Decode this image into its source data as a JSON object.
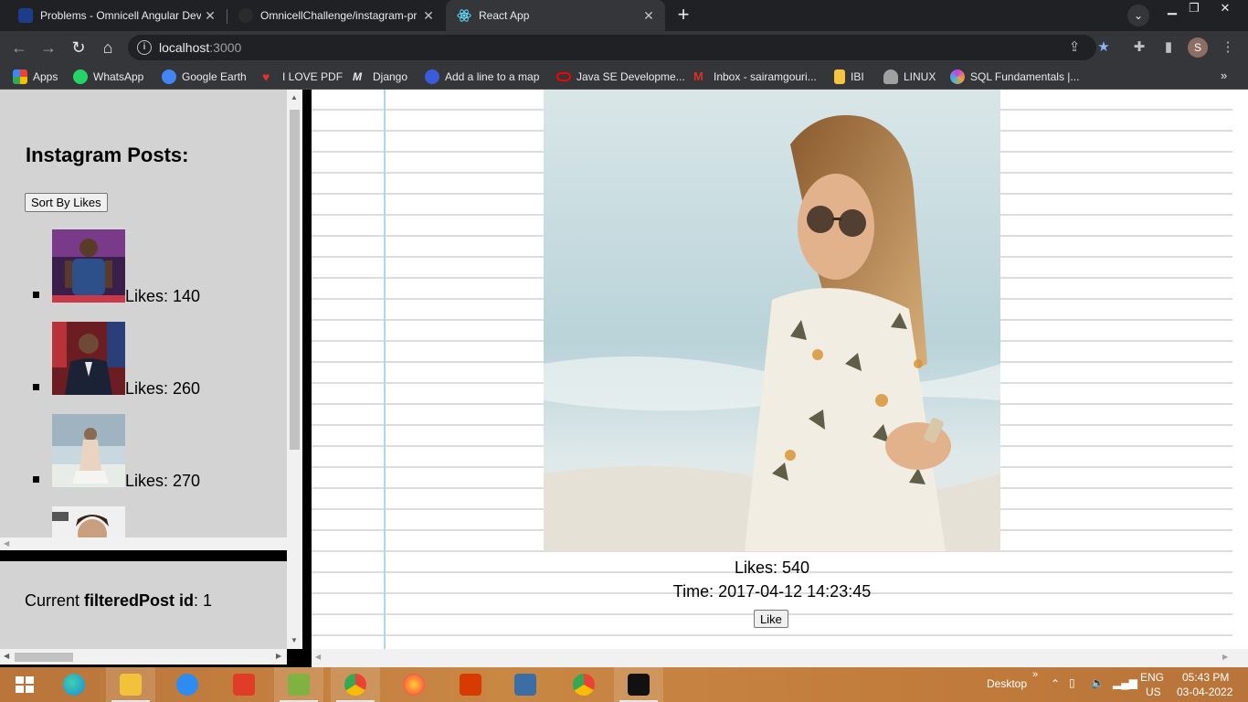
{
  "browser": {
    "tabs": [
      {
        "title": "Problems - Omnicell Angular Dev",
        "active": false,
        "favicon_color": "#1f3c88"
      },
      {
        "title": "OmnicellChallenge/instagram-pr",
        "active": false,
        "favicon_color": "#2b2b2b"
      },
      {
        "title": "React App",
        "active": true,
        "favicon_color": "#61dafb"
      }
    ],
    "tab_close_glyph": "✕",
    "new_tab_glyph": "+",
    "url_host": "localhost",
    "url_port": ":3000",
    "bookmarks": [
      {
        "label": "Apps",
        "icon": "apps-grid-icon",
        "color": "#ea4335"
      },
      {
        "label": "WhatsApp",
        "icon": "whatsapp-icon",
        "color": "#25d366"
      },
      {
        "label": "Google Earth",
        "icon": "google-earth-icon",
        "color": "#4285f4"
      },
      {
        "label": "I LOVE PDF",
        "icon": "heart-icon",
        "color": "#e5322d"
      },
      {
        "label": "Django",
        "icon": "django-icon",
        "color": "#0c4b33"
      },
      {
        "label": "Add a line to a map",
        "icon": "map-icon",
        "color": "#3b5bdb"
      },
      {
        "label": "Java SE Developme...",
        "icon": "oracle-icon",
        "color": "#f80000"
      },
      {
        "label": "Inbox - sairamgouri...",
        "icon": "gmail-icon",
        "color": "#d93025"
      },
      {
        "label": "IBI",
        "icon": "folder-icon",
        "color": "#f5c542"
      },
      {
        "label": "LINUX",
        "icon": "linux-icon",
        "color": "#a0a0a0"
      },
      {
        "label": "SQL Fundamentals |...",
        "icon": "sql-icon",
        "color": "#c53fe0"
      }
    ],
    "bookmarks_more": "»",
    "profile_initial": "S"
  },
  "page": {
    "posts_title": "Instagram Posts:",
    "sort_button": "Sort By Likes",
    "posts": [
      {
        "likes_text": "Likes: 140",
        "thumb": "basketball-player"
      },
      {
        "likes_text": "Likes: 260",
        "thumb": "man-in-suit"
      },
      {
        "likes_text": "Likes: 270",
        "thumb": "woman-by-water"
      },
      {
        "likes_text": "",
        "thumb": "portrait-partial"
      }
    ],
    "status": {
      "prefix": "Current ",
      "bold": "filteredPost id",
      "suffix": ": 1"
    },
    "detail": {
      "likes": "Likes: 540",
      "time": "Time: 2017-04-12 14:23:45",
      "like_button": "Like"
    }
  },
  "taskbar": {
    "apps": [
      {
        "name": "start-button",
        "color": "#ffffff"
      },
      {
        "name": "edge-icon",
        "color": "#1c8ad6"
      },
      {
        "name": "file-explorer-icon",
        "color": "#f3c23b"
      },
      {
        "name": "sync-icon",
        "color": "#2d8cf0"
      },
      {
        "name": "headphones-icon",
        "color": "#e03c28"
      },
      {
        "name": "notepad-plus-icon",
        "color": "#7fb241"
      },
      {
        "name": "chrome-profile-icon",
        "color": "#4285f4"
      },
      {
        "name": "firefox-icon",
        "color": "#ff7139"
      },
      {
        "name": "office-icon",
        "color": "#d83b01"
      },
      {
        "name": "remote-desktop-icon",
        "color": "#3a6ea5"
      },
      {
        "name": "chrome-icon",
        "color": "#34a853"
      },
      {
        "name": "terminal-icon",
        "color": "#111111"
      }
    ],
    "desktop_label": "Desktop",
    "desktop_chevron": "»",
    "lang_top": "ENG",
    "lang_bottom": "US",
    "time": "05:43 PM",
    "date": "03-04-2022"
  }
}
